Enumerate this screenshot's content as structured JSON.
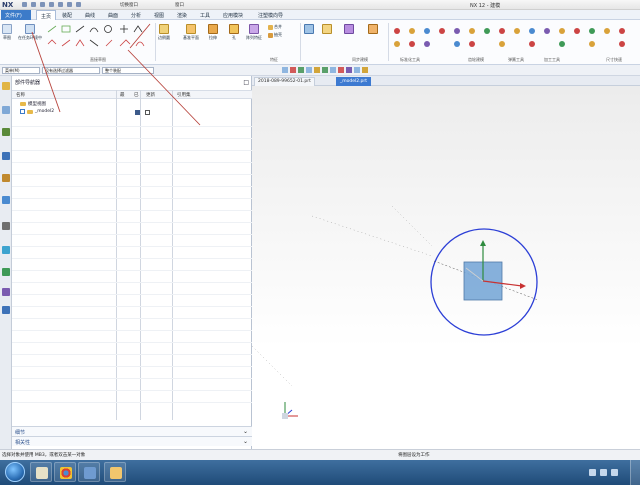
{
  "app": {
    "logo": "NX",
    "title": "NX 12 - 建模",
    "quick_access": [
      "切换窗口",
      "窗口"
    ]
  },
  "menu": {
    "file": "文件(F)",
    "tabs": [
      "主页",
      "装配",
      "曲线",
      "曲面",
      "分析",
      "视图",
      "渲染",
      "工具",
      "应用模块",
      "注塑模向导"
    ]
  },
  "ribbon": {
    "sketch": "草图",
    "sketch_in_task": "在任务环境中",
    "group_direct_sketch": "直接草图",
    "datum_plane": "基准平面",
    "extrude": "拉伸",
    "hole": "孔",
    "pattern_feature": "阵列特征",
    "merge": "合并",
    "shell": "抽壳",
    "group_feature": "特征",
    "edge_blend": "边倒圆",
    "group_synchronous": "同步建模",
    "group_surface": "曲面",
    "group_standard": "标准化工具",
    "group_gear": "齿轮建模",
    "group_spring": "弹簧工具",
    "group_processing": "加工工具",
    "group_size": "尺寸快速"
  },
  "selection": {
    "filter": "没有选择过滤器",
    "scope": "整个装配",
    "filter_label": "菜单(M)"
  },
  "navigator": {
    "title": "部件导航器",
    "columns": [
      "名称",
      "最",
      "已",
      "更新",
      "引用集"
    ],
    "items": [
      "模型视图",
      "_model2"
    ],
    "footer": [
      "细节",
      "相关性"
    ]
  },
  "graphics": {
    "tabs": [
      "2018-089-99652-01.prt",
      "_model2.prt"
    ]
  },
  "status": {
    "left": "选择对象并使用 MB3，或者双击某一对象",
    "right": "将图层设为工作"
  },
  "colors": {
    "accent": "#3c7bc9",
    "circle": "#2c3fd6",
    "cube": "#7aa9d8"
  }
}
